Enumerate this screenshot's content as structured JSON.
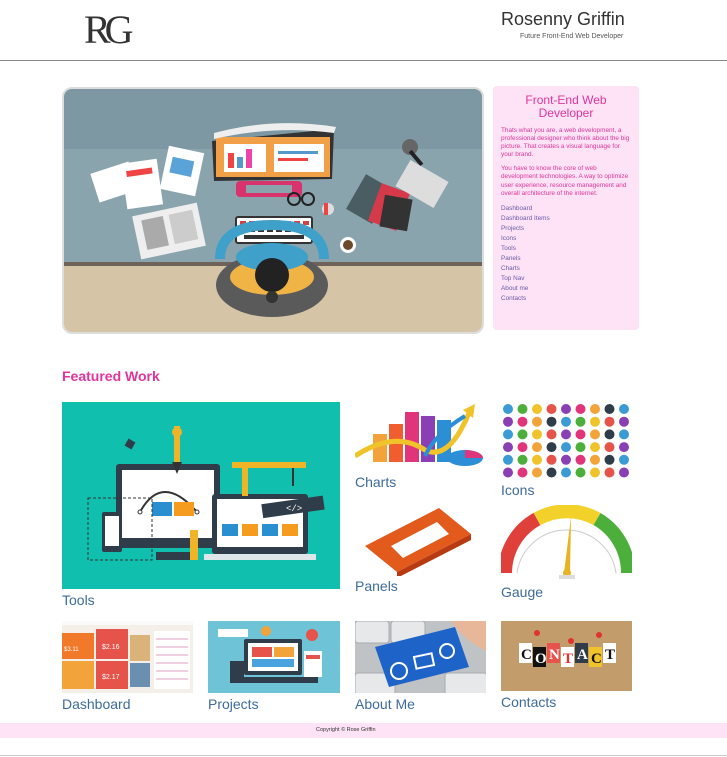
{
  "header": {
    "logo_text": "RG",
    "name": "Rosenny Griffin",
    "tagline": "Future Front-End Web Developer"
  },
  "sidebar": {
    "title": "Front-End Web Developer",
    "paragraphs": [
      "Thats what you are, a web development, a professional designer who think about the big picture. That creates a visual language for your brand.",
      "You have to know the core of web development technologies. A way to optimize user experience, resource management and overall architecture of the internet."
    ],
    "links": [
      "Dashboard",
      "Dashboard Items",
      "Projects",
      "Icons",
      "Tools",
      "Panels",
      "Charts",
      "Top Nav",
      "About me",
      "Contacts"
    ]
  },
  "featured": {
    "heading": "Featured Work",
    "items": {
      "tools": "Tools",
      "charts": "Charts",
      "icons": "Icons",
      "panels": "Panels",
      "gauge": "Gauge",
      "dashboard": "Dashboard",
      "projects": "Projects",
      "about": "About Me",
      "contacts": "Contacts"
    },
    "contact_letters": "CONTACT",
    "dashboard_values": [
      "$2.16",
      "$3.11",
      "$2.17"
    ]
  },
  "footer": {
    "copyright": "Copyright © Rose Griffin"
  },
  "colors": {
    "accent_pink": "#e0359b",
    "sidebar_bg": "#fde3f5",
    "caption_blue": "#3d6b9c",
    "link_purple": "#6a5ba8",
    "tools_teal": "#11bfae"
  }
}
